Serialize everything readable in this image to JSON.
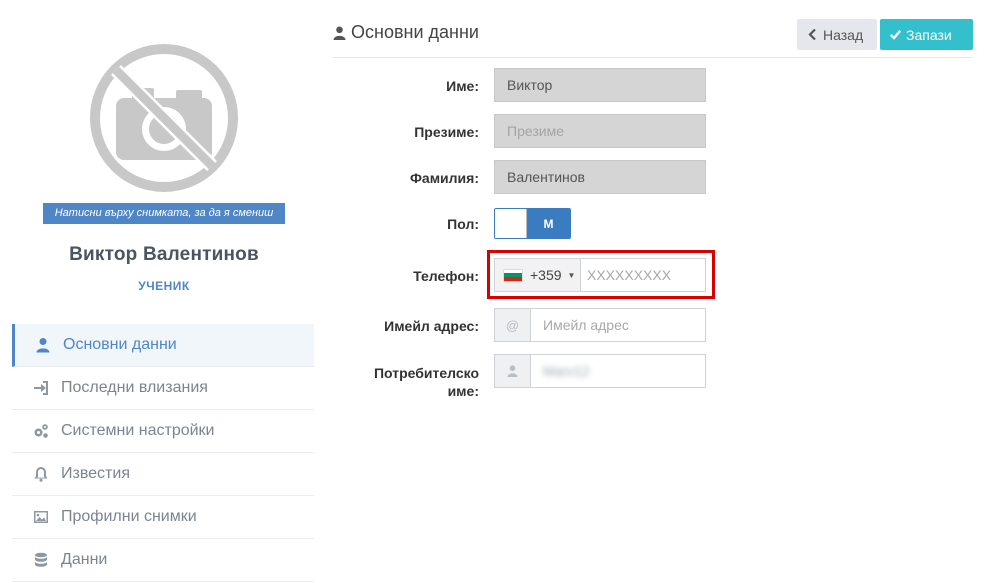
{
  "profile": {
    "photo_hint": "Натисни върху снимката, за да я смениш",
    "name": "Виктор Валентинов",
    "role": "УЧЕНИК"
  },
  "menu": [
    {
      "label": "Основни данни",
      "icon": "user-icon",
      "active": true
    },
    {
      "label": "Последни влизания",
      "icon": "sign-in-icon"
    },
    {
      "label": "Системни настройки",
      "icon": "cogs-icon"
    },
    {
      "label": "Известия",
      "icon": "bell-icon"
    },
    {
      "label": "Профилни снимки",
      "icon": "image-icon"
    },
    {
      "label": "Данни",
      "icon": "database-icon"
    }
  ],
  "header": {
    "title": "Основни данни",
    "back_label": "Назад",
    "save_label": "Запази"
  },
  "form": {
    "first_name": {
      "label": "Име:",
      "value": "Виктор"
    },
    "middle_name": {
      "label": "Презиме:",
      "placeholder": "Презиме"
    },
    "last_name": {
      "label": "Фамилия:",
      "value": "Валентинов"
    },
    "gender": {
      "label": "Пол:",
      "value": "М"
    },
    "phone": {
      "label": "Телефон:",
      "country_code": "+359",
      "placeholder": "XXXXXXXXX"
    },
    "email": {
      "label": "Имейл адрес:",
      "addon": "@",
      "placeholder": "Имейл адрес"
    },
    "username": {
      "label": "Потребителско име:",
      "value": "Marv12"
    }
  },
  "colors": {
    "accent": "#4f86c6",
    "save": "#33bfcb",
    "highlight": "#d90000"
  }
}
